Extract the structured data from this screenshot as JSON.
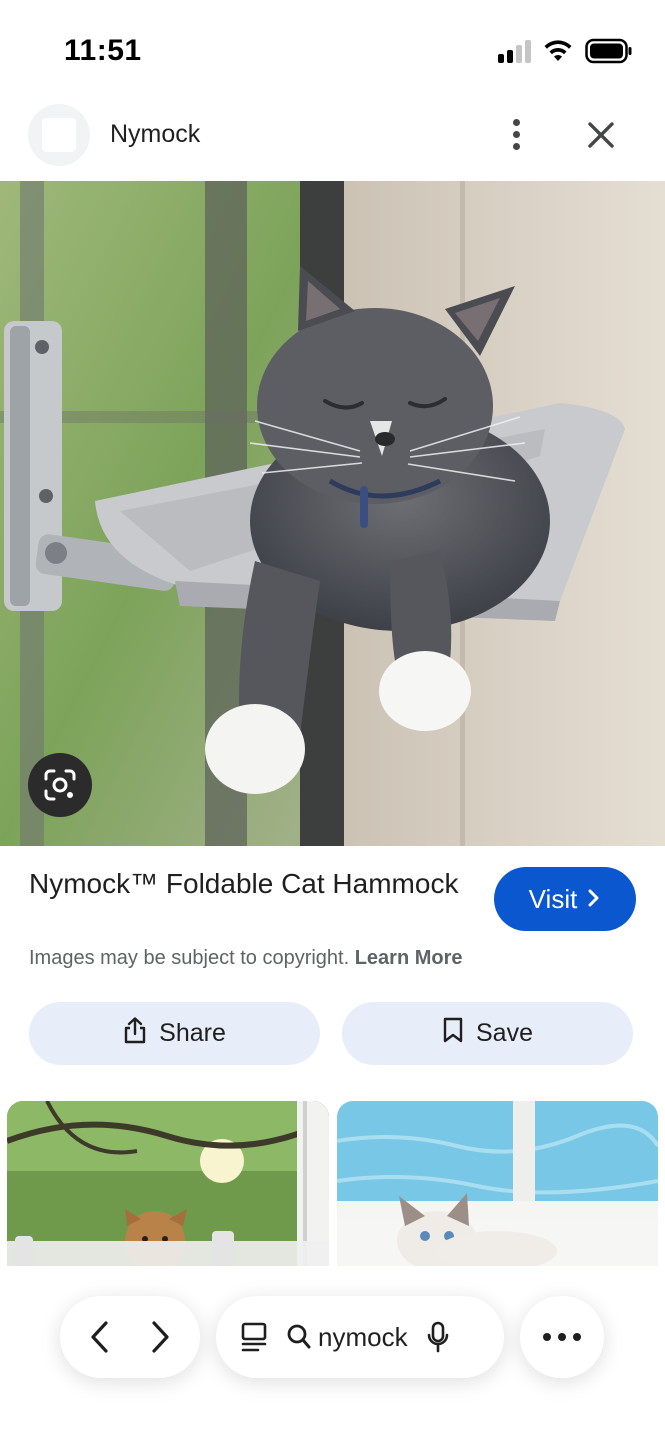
{
  "status_bar": {
    "time": "11:51",
    "icons": [
      "cellular-signal-icon",
      "wifi-icon",
      "battery-icon"
    ]
  },
  "header": {
    "site_name": "Nymock",
    "menu_icon": "more-vert-icon",
    "close_icon": "close-icon"
  },
  "image": {
    "lens_icon": "google-lens-icon"
  },
  "result": {
    "title": "Nymock™ Foldable Cat Hammock",
    "visit_label": "Visit",
    "copyright_text": "Images may be subject to copyright.",
    "learn_more": "Learn More"
  },
  "actions": {
    "share_label": "Share",
    "save_label": "Save"
  },
  "bottom_nav": {
    "search_query": "nymock",
    "icons": [
      "back-icon",
      "forward-icon",
      "tabs-icon",
      "search-icon",
      "microphone-icon",
      "more-icon"
    ]
  },
  "colors": {
    "accent": "#0b57d0",
    "action_button_bg": "#e8eef9",
    "secondary_text": "#5f6368"
  }
}
